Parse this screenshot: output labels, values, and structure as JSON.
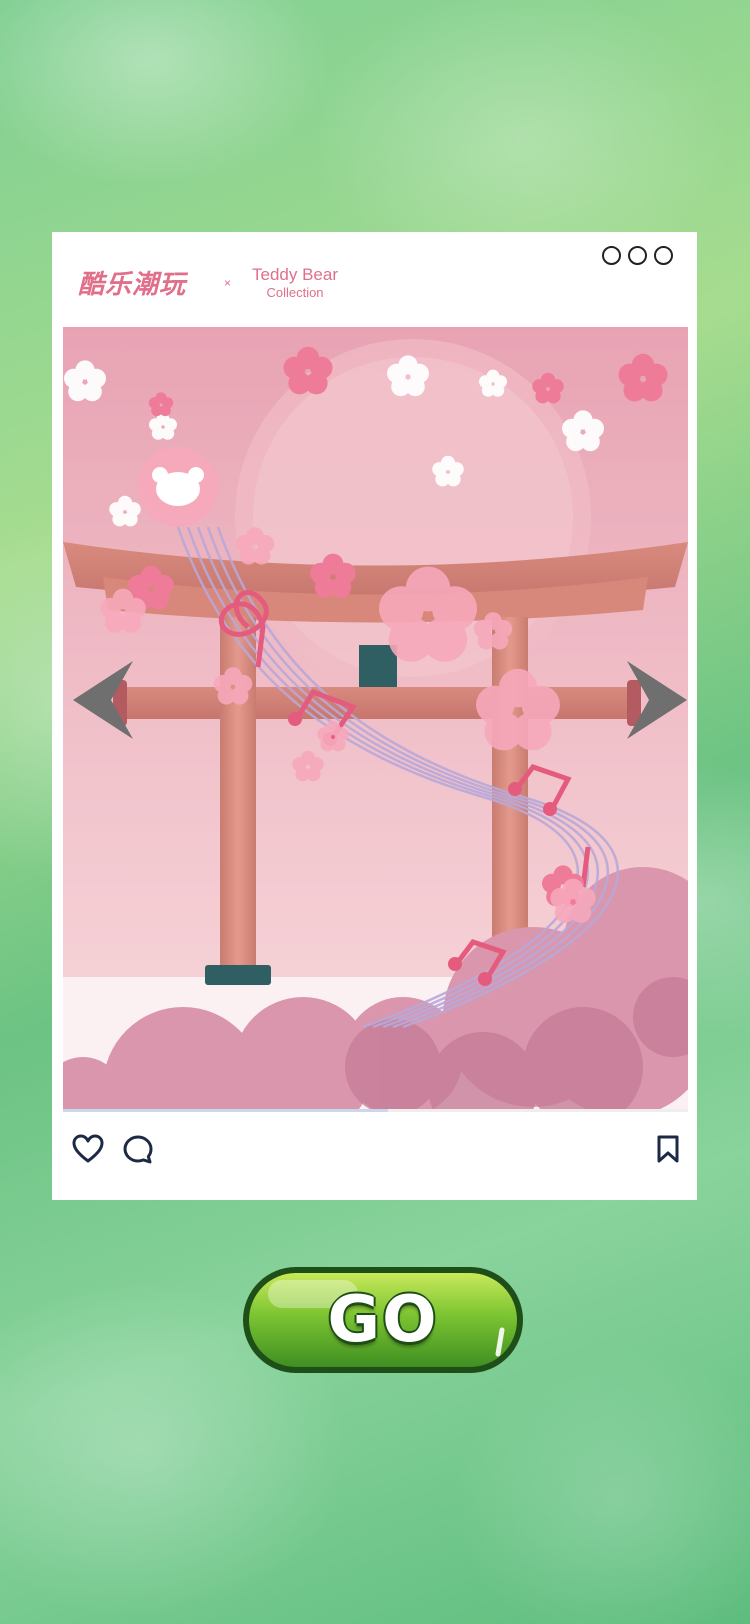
{
  "header": {
    "brand_cn": "酷乐潮玩",
    "brand_separator": "×",
    "brand_en_line1": "Teddy Bear",
    "brand_en_line2": "Collection",
    "menu_icon": "more-dots-icon"
  },
  "post": {
    "image": "sakura-torii-gate-illustration",
    "actions": {
      "like_icon": "heart-icon",
      "comment_icon": "comment-icon",
      "save_icon": "bookmark-icon"
    },
    "scroll_progress": 0.52
  },
  "navigation": {
    "prev_icon": "chevron-left-icon",
    "next_icon": "chevron-right-icon"
  },
  "cta": {
    "label": "GO"
  },
  "colors": {
    "brand_pink": "#e06f8a",
    "background_green": "#7fcf92",
    "button_green": "#7cc431",
    "arrow_gray": "#6f6f6f"
  }
}
